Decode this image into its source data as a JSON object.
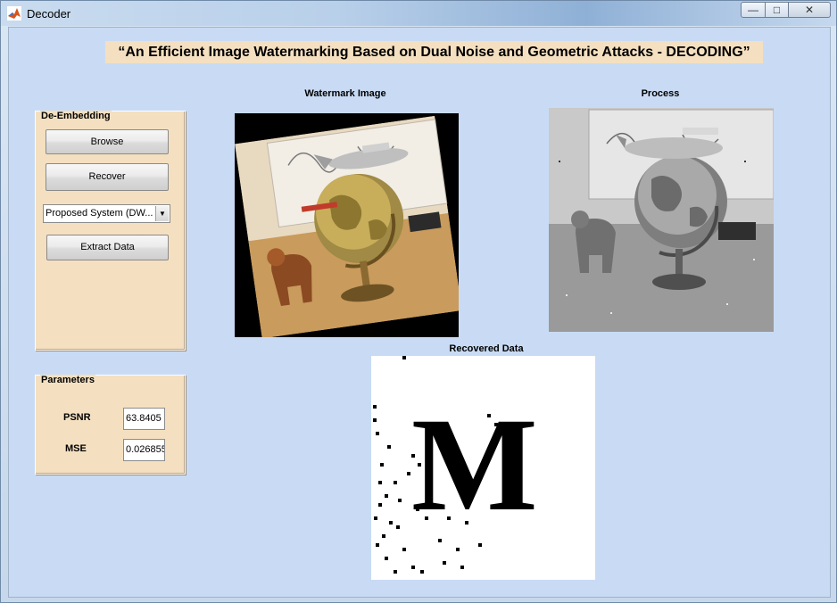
{
  "window": {
    "title": "Decoder",
    "minimize_glyph": "—",
    "maximize_glyph": "□",
    "close_glyph": "✕"
  },
  "heading": "“An Efficient Image Watermarking Based on Dual Noise and Geometric Attacks - DECODING”",
  "de_embedding": {
    "title": "De-Embedding",
    "browse_label": "Browse",
    "recover_label": "Recover",
    "method_select": "Proposed System (DW...",
    "extract_label": "Extract Data"
  },
  "parameters": {
    "title": "Parameters",
    "psnr_label": "PSNR",
    "psnr_value": "63.8405",
    "mse_label": "MSE",
    "mse_value": "0.026855"
  },
  "captions": {
    "watermark": "Watermark Image",
    "process": "Process",
    "recovered": "Recovered Data"
  },
  "recovered_letter": "M",
  "colors": {
    "client_bg": "#c9dbf4",
    "panel_bg": "#f4e0c0"
  }
}
